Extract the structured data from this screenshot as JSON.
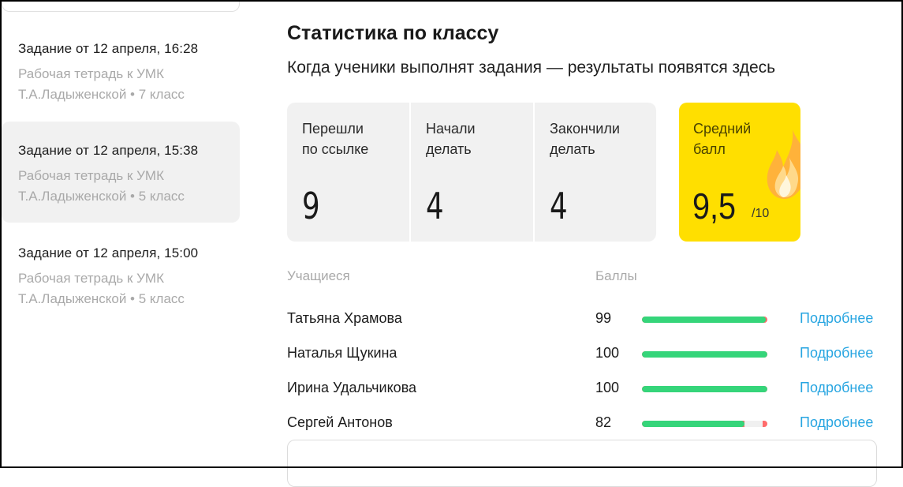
{
  "sidebar": {
    "tasks": [
      {
        "title": "Задание от 12 апреля, 16:28",
        "line1": "Рабочая тетрадь к УМК",
        "line2": "Т.А.Ладыженской • 7 класс",
        "selected": false
      },
      {
        "title": "Задание от 12 апреля, 15:38",
        "line1": "Рабочая тетрадь к УМК",
        "line2": "Т.А.Ладыженской • 5 класс",
        "selected": true
      },
      {
        "title": "Задание от 12 апреля, 15:00",
        "line1": "Рабочая тетрадь к УМК",
        "line2": "Т.А.Ладыженской • 5 класс",
        "selected": false
      }
    ]
  },
  "main": {
    "title": "Статистика по классу",
    "subtitle": "Когда ученики выполнят задания — результаты появятся здесь",
    "stats": [
      {
        "label": "Перешли по ссылке",
        "label_l1": "Перешли",
        "label_l2": "по ссылке",
        "value": "9"
      },
      {
        "label": "Начали делать",
        "label_l1": "Начали",
        "label_l2": "делать",
        "value": "4"
      },
      {
        "label": "Закончили делать",
        "label_l1": "Закончили",
        "label_l2": "делать",
        "value": "4"
      }
    ],
    "average": {
      "label_l1": "Средний",
      "label_l2": "балл",
      "value": "9,5",
      "max": "/10",
      "icon": "flame-icon",
      "color": "#ffdf00"
    },
    "columns": {
      "students": "Учащиеся",
      "scores": "Баллы"
    },
    "students": [
      {
        "name": "Татьяна Храмова",
        "score": "99",
        "score_fraction": 0.99,
        "link": "Подробнее"
      },
      {
        "name": "Наталья Щукина",
        "score": "100",
        "score_fraction": 1.0,
        "link": "Подробнее"
      },
      {
        "name": "Ирина Удальчикова",
        "score": "100",
        "score_fraction": 1.0,
        "link": "Подробнее"
      },
      {
        "name": "Сергей Антонов",
        "score": "82",
        "score_fraction": 0.82,
        "link": "Подробнее"
      }
    ],
    "colors": {
      "bar_good": "#35d57a",
      "bar_bad": "#ff6b6b",
      "link": "#27a5e1",
      "accent": "#ffdf00"
    }
  }
}
